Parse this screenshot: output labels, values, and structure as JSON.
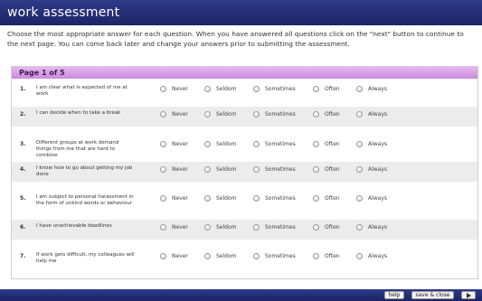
{
  "window": {
    "title": "work assessment"
  },
  "instructions": "Choose the most appropriate answer for each question. When you have answered all questions click on the \"next\" button to continue to the next page. You can come back later and change your answers prior to submitting the assessment.",
  "panel": {
    "title": "Page 1 of 5"
  },
  "options": [
    "Never",
    "Seldom",
    "Sometimes",
    "Often",
    "Always"
  ],
  "questions": [
    {
      "num": "1.",
      "text": "I am clear what is expected of me at work"
    },
    {
      "num": "2.",
      "text": "I can decide when to take a break"
    },
    {
      "num": "3.",
      "text": "Different groups at work demand things from me that are hard to combine"
    },
    {
      "num": "4.",
      "text": "I know how to go about getting my job done"
    },
    {
      "num": "5.",
      "text": "I am subject to personal harassment in the form of unkind words or behaviour"
    },
    {
      "num": "6.",
      "text": "I have unachievable deadlines"
    },
    {
      "num": "7.",
      "text": "If work gets difficult, my colleagues will help me"
    }
  ],
  "footer": {
    "help_label": "help",
    "save_label": "save & close",
    "next_icon": "play-triangle-icon"
  },
  "colors": {
    "title_bar": "#1c2464",
    "panel_header": "#c98bdb",
    "alt_row": "#ececec"
  }
}
